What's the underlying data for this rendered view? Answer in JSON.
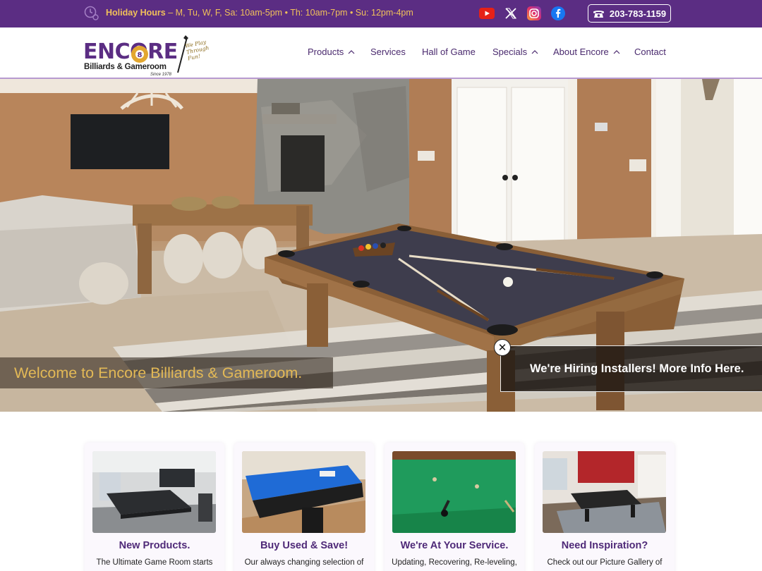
{
  "topbar": {
    "hours_label": "Holiday Hours",
    "hours_text": "– M, Tu, W, F, Sa: 10am-5pm • Th: 10am-7pm • Su: 12pm-4pm",
    "phone": "203-783-1159",
    "social": [
      "youtube-icon",
      "x-icon",
      "instagram-icon",
      "facebook-icon"
    ],
    "color": "#5b2d83",
    "accent": "#f0c05a"
  },
  "logo": {
    "word": "ENCORE",
    "sub": "Billiards & Gameroom",
    "since": "Since 1978",
    "tagline": "We Play Through Fun!"
  },
  "nav": {
    "items": [
      {
        "label": "Products",
        "has_caret": true
      },
      {
        "label": "Services",
        "has_caret": false
      },
      {
        "label": "Hall of Game",
        "has_caret": false
      },
      {
        "label": "Specials",
        "has_caret": true
      },
      {
        "label": "About Encore",
        "has_caret": true
      },
      {
        "label": "Contact",
        "has_caret": false
      }
    ]
  },
  "hero": {
    "welcome": "Welcome to Encore Billiards & Gameroom.",
    "hiring": "We're Hiring Installers! More Info Here.",
    "close_label": "✕"
  },
  "cards": [
    {
      "title": "New Products.",
      "desc": "The Ultimate Game Room starts"
    },
    {
      "title": "Buy Used & Save!",
      "desc": "Our always changing selection of"
    },
    {
      "title": "We're At Your Service.",
      "desc": "Updating, Recovering, Re-leveling,"
    },
    {
      "title": "Need Inspiration?",
      "desc": "Check out our Picture Gallery of"
    }
  ]
}
